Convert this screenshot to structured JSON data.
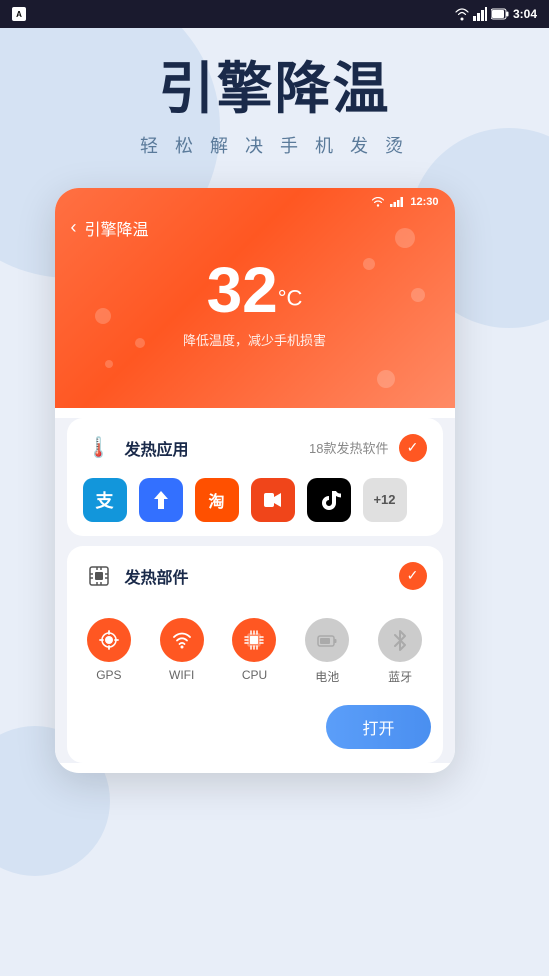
{
  "statusBar": {
    "appIcon": "A",
    "time": "3:04",
    "icons": [
      "wifi",
      "signal",
      "battery"
    ]
  },
  "hero": {
    "title": "引擎降温",
    "subtitle": "轻 松 解 决 手 机 发 烫"
  },
  "phoneScreen": {
    "statusTime": "12:30",
    "navBack": "‹",
    "navTitle": "引擎降温",
    "temperature": "32",
    "tempUnit": "°C",
    "tempDesc": "降低温度，减少手机损害"
  },
  "heatingApps": {
    "icon": "🌡",
    "title": "发热应用",
    "meta": "18款发热软件",
    "checked": true,
    "apps": [
      {
        "name": "支付宝",
        "colorClass": "app-alipay",
        "symbol": "支"
      },
      {
        "name": "飞书",
        "colorClass": "app-feishu",
        "symbol": "✦"
      },
      {
        "name": "淘宝",
        "colorClass": "app-taobao",
        "symbol": "淘"
      },
      {
        "name": "快手",
        "colorClass": "app-kuaishou",
        "symbol": "⊞"
      },
      {
        "name": "抖音",
        "colorClass": "app-tiktok",
        "symbol": "♪"
      },
      {
        "name": "+12",
        "colorClass": "app-more",
        "symbol": "+12"
      }
    ]
  },
  "heatingComponents": {
    "icon": "⊙",
    "title": "发热部件",
    "checked": true,
    "components": [
      {
        "label": "GPS",
        "active": true,
        "icon": "◎"
      },
      {
        "label": "WIFI",
        "active": true,
        "icon": "((·))"
      },
      {
        "label": "CPU",
        "active": true,
        "icon": "⬛"
      },
      {
        "label": "电池",
        "active": false,
        "icon": "▭"
      },
      {
        "label": "蓝牙",
        "active": false,
        "icon": "*"
      }
    ]
  },
  "openButton": {
    "label": "打开"
  }
}
